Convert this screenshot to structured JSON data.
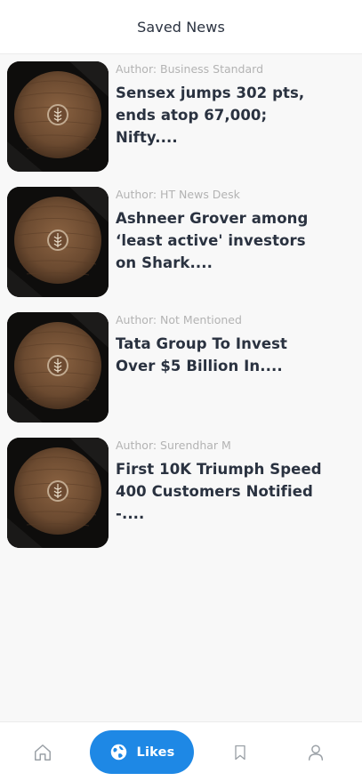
{
  "header": {
    "title": "Saved News"
  },
  "articles": [
    {
      "author": "Author: Business Standard",
      "title": "Sensex jumps 302 pts, ends atop 67,000; Nifty...."
    },
    {
      "author": "Author: HT News Desk",
      "title": "Ashneer Grover among ‘least active' investors on Shark...."
    },
    {
      "author": "Author: Not Mentioned",
      "title": "Tata Group To Invest Over $5 Billion In...."
    },
    {
      "author": "Author: Surendhar M",
      "title": "First 10K Triumph Speed 400 Customers Notified -...."
    }
  ],
  "bottom_nav": {
    "items": [
      {
        "icon": "home-icon"
      },
      {
        "icon": "globe-icon",
        "label": "Likes",
        "active": true
      },
      {
        "icon": "bookmark-icon"
      },
      {
        "icon": "person-icon"
      }
    ]
  },
  "colors": {
    "accent": "#1e88e5",
    "text_primary": "#2a3240",
    "text_muted": "#b3b3b3",
    "background": "#f8f8f8"
  }
}
